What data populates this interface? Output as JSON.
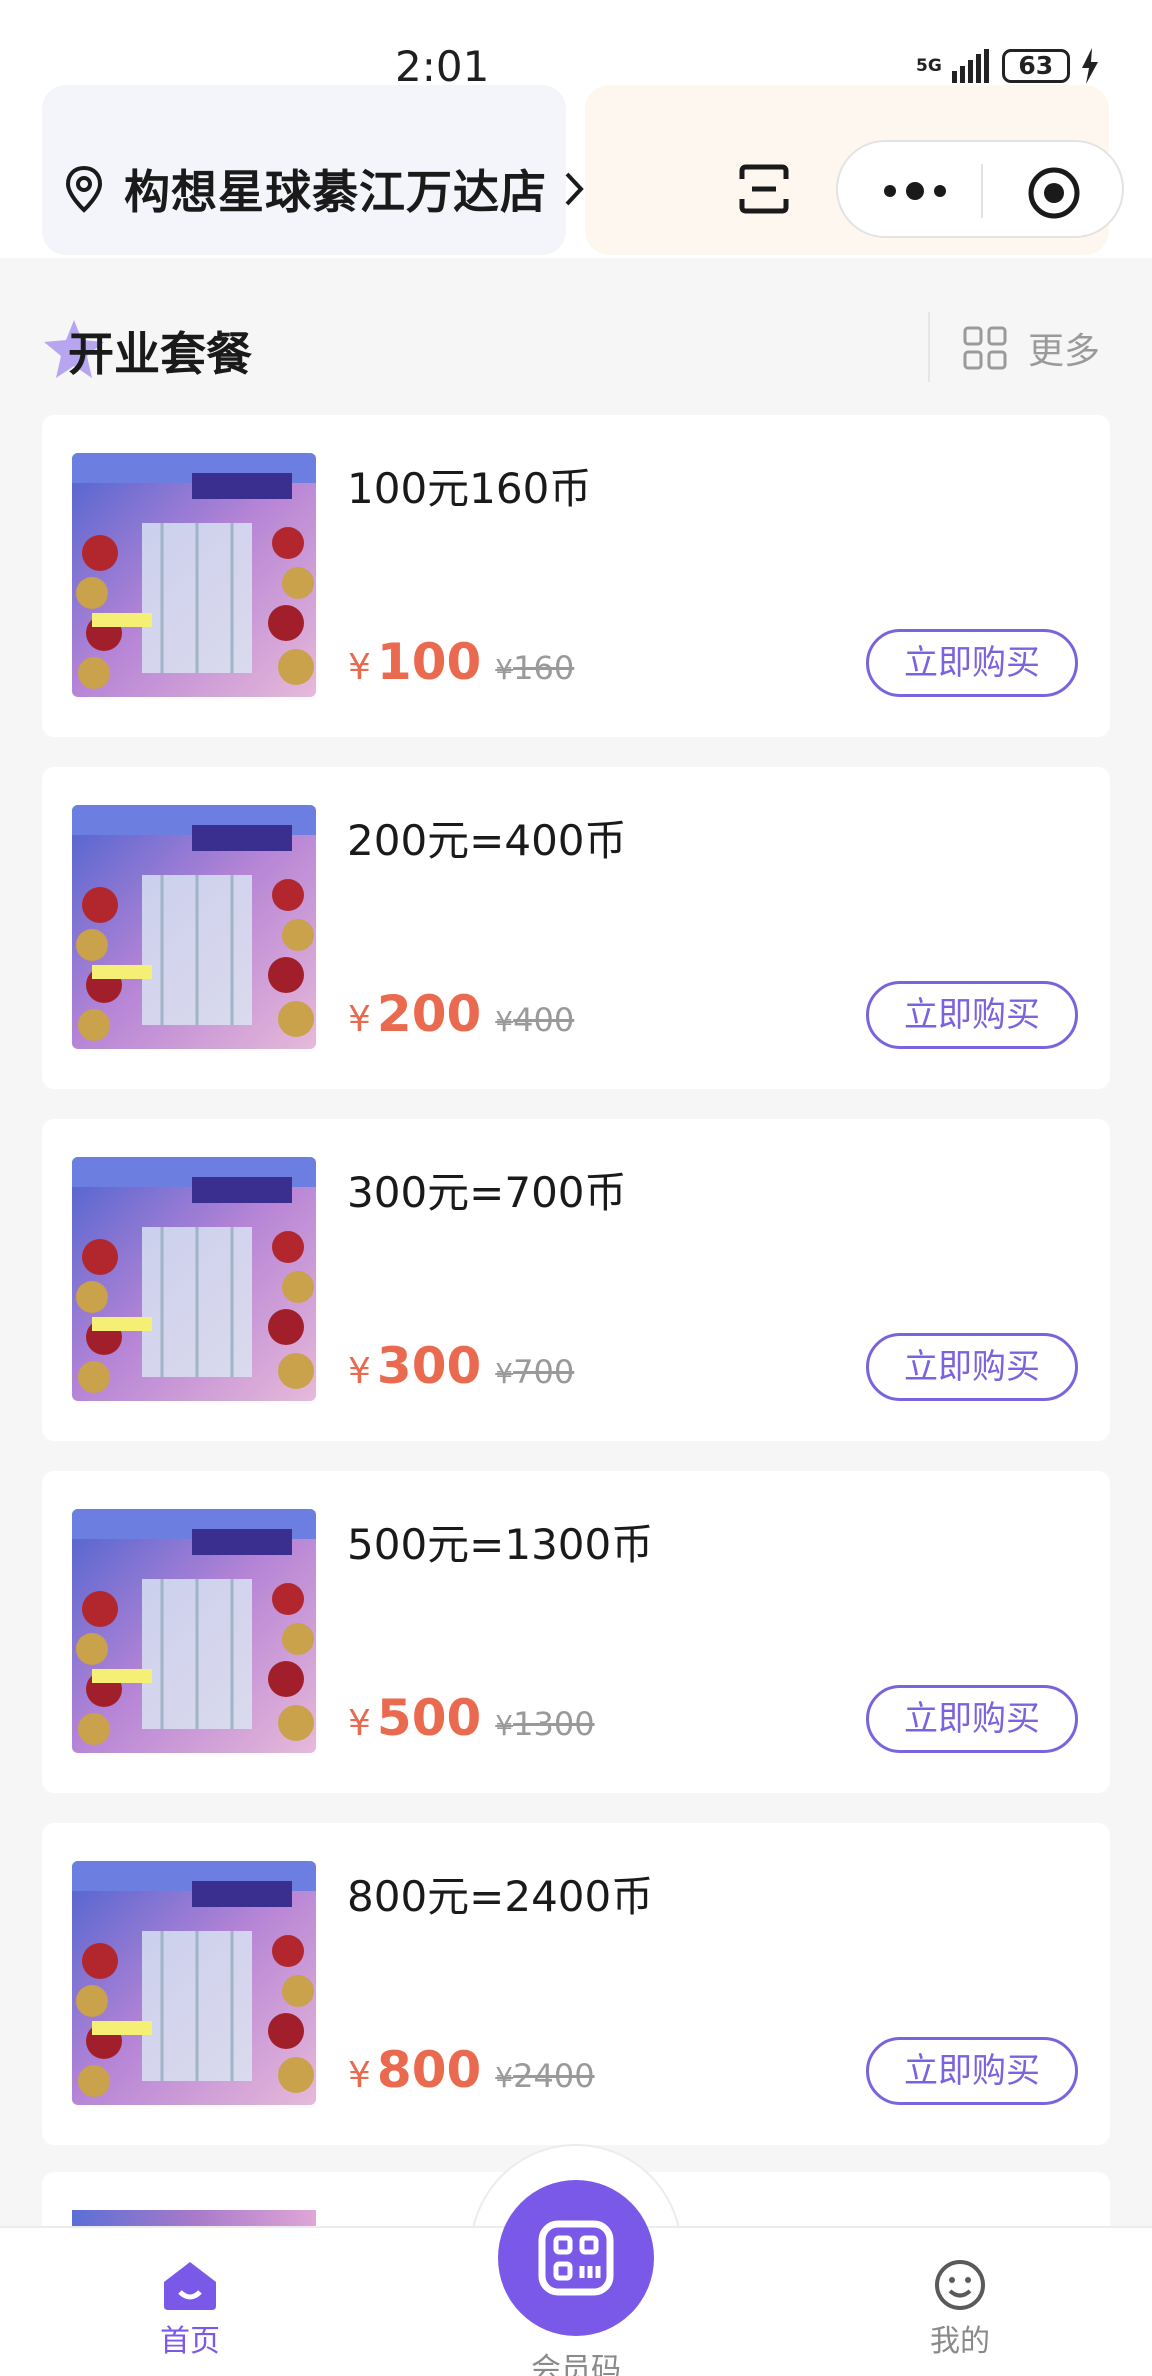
{
  "status_bar": {
    "time": "2:01",
    "network": "5G",
    "battery": "63"
  },
  "header": {
    "store_name": "构想星球綦江万达店"
  },
  "section": {
    "title": "开业套餐",
    "more_label": "更多"
  },
  "products": [
    {
      "title": "100元160币",
      "currency": "¥",
      "price": "100",
      "original_currency": "¥",
      "original_price": "160",
      "buy_label": "立即购买"
    },
    {
      "title": "200元=400币",
      "currency": "¥",
      "price": "200",
      "original_currency": "¥",
      "original_price": "400",
      "buy_label": "立即购买"
    },
    {
      "title": "300元=700币",
      "currency": "¥",
      "price": "300",
      "original_currency": "¥",
      "original_price": "700",
      "buy_label": "立即购买"
    },
    {
      "title": "500元=1300币",
      "currency": "¥",
      "price": "500",
      "original_currency": "¥",
      "original_price": "1300",
      "buy_label": "立即购买"
    },
    {
      "title": "800元=2400币",
      "currency": "¥",
      "price": "800",
      "original_currency": "¥",
      "original_price": "2400",
      "buy_label": "立即购买"
    }
  ],
  "bottom_nav": {
    "items": [
      {
        "label": "首页",
        "icon": "home-icon",
        "active": true
      },
      {
        "label": "会员码",
        "icon": "qr-code-icon",
        "active": false
      },
      {
        "label": "我的",
        "icon": "smile-icon",
        "active": false
      }
    ]
  },
  "colors": {
    "accent": "#7b59e8",
    "price": "#ea6a4f",
    "button_border": "#7b63de"
  }
}
